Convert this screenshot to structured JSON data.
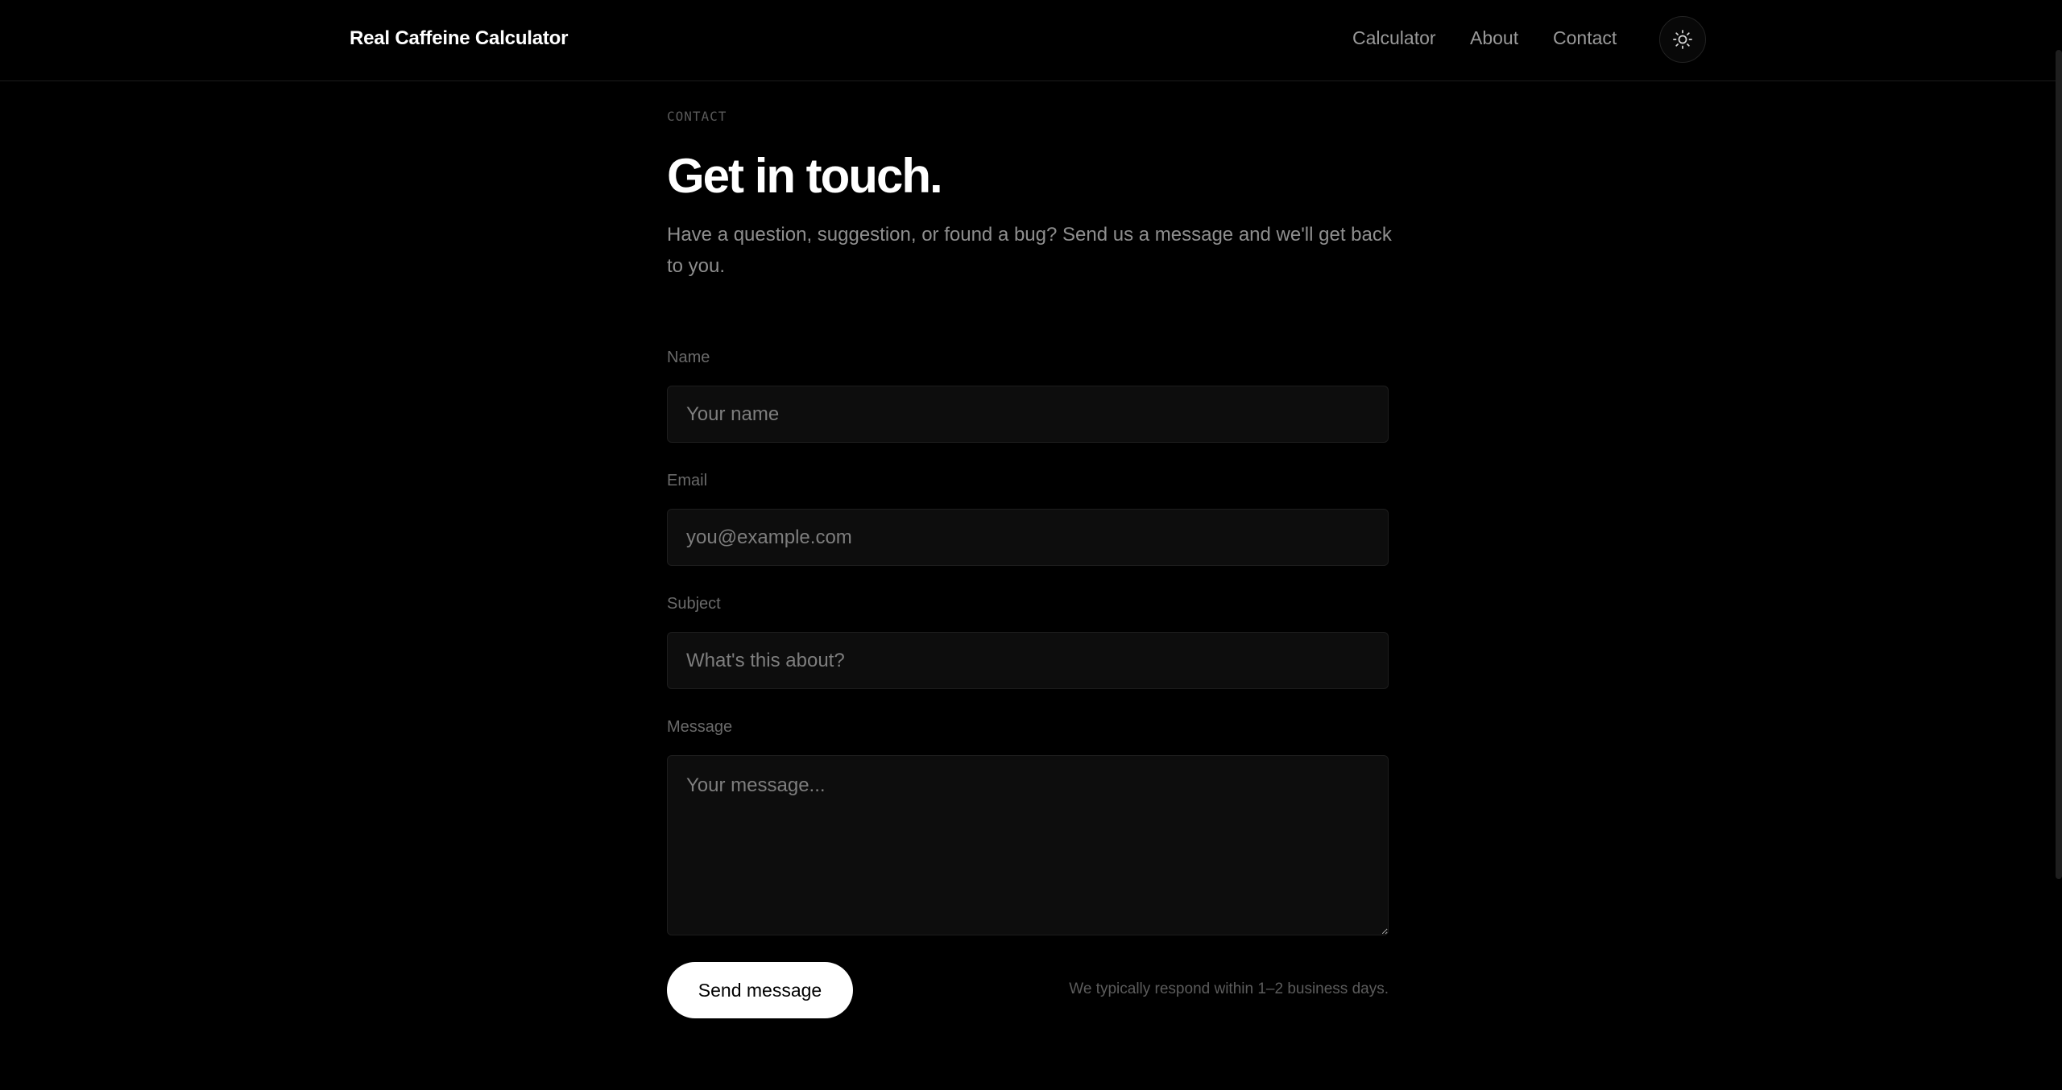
{
  "header": {
    "brand": "Real Caffeine Calculator",
    "nav": [
      "Calculator",
      "About",
      "Contact"
    ],
    "theme_toggle_icon": "sun-icon"
  },
  "page": {
    "eyebrow": "CONTACT",
    "title": "Get in touch.",
    "subtitle": "Have a question, suggestion, or found a bug? Send us a message and we'll get back to you."
  },
  "form": {
    "name": {
      "label": "Name",
      "placeholder": "Your name",
      "value": ""
    },
    "email": {
      "label": "Email",
      "placeholder": "you@example.com",
      "value": ""
    },
    "subject": {
      "label": "Subject",
      "placeholder": "What's this about?",
      "value": ""
    },
    "message": {
      "label": "Message",
      "placeholder": "Your message...",
      "value": ""
    },
    "submit_label": "Send message",
    "note": "We typically respond within 1–2 business days."
  },
  "colors": {
    "background": "#000000",
    "text": "#ffffff",
    "muted": "#8e8e8e",
    "button_bg": "#ffffff",
    "button_text": "#000000"
  }
}
